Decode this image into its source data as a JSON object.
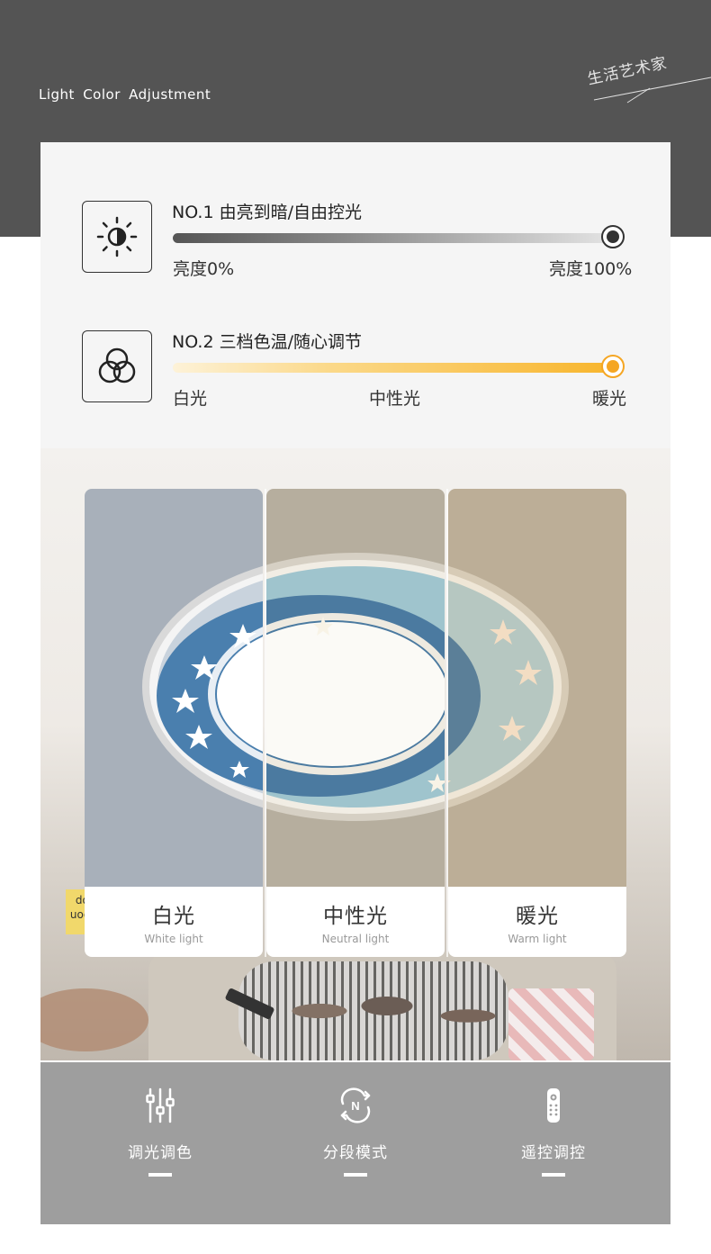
{
  "header": {
    "title": "Light  Color  Adjustment",
    "brand": "生活艺术家"
  },
  "features": [
    {
      "title": "NO.1  由亮到暗/自由控光",
      "icon": "brightness-sun-icon",
      "level": 1.0,
      "labels": [
        "亮度0%",
        "亮度100%"
      ]
    },
    {
      "title": "NO.2  三档色温/随心调节",
      "icon": "color-temperature-circles-icon",
      "level": 1.0,
      "labels": [
        "白光",
        "中性光",
        "暖光"
      ]
    }
  ],
  "modes": [
    {
      "name": "白光",
      "english": "White light",
      "tint": "#a8b0ba"
    },
    {
      "name": "中性光",
      "english": "Neutral light",
      "tint": "#b6ae9e"
    },
    {
      "name": "暖光",
      "english": "Warm light",
      "tint": "#bcae97"
    }
  ],
  "scene": {
    "book_text": "dol\nuoqd"
  },
  "functions": [
    {
      "label": "调光调色",
      "icon": "sliders-icon"
    },
    {
      "label": "分段模式",
      "icon": "cycle-n-icon"
    },
    {
      "label": "遥控调控",
      "icon": "remote-control-icon"
    }
  ],
  "colors": {
    "top_band": "#545454",
    "card": "#f5f5f5",
    "bottom_band": "#9e9e9e",
    "warm_accent": "#f5a623",
    "lamp_blue": "#4a7fae"
  }
}
